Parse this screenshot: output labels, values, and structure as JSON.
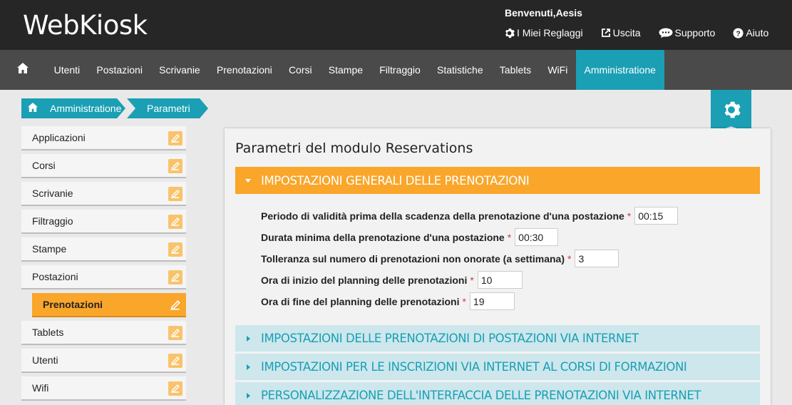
{
  "header": {
    "logo": "WebKiosk",
    "welcome": "Benvenuti,Aesis",
    "links": [
      {
        "label": "I Miei Reglaggi",
        "icon": "gear-icon"
      },
      {
        "label": "Uscita",
        "icon": "exit-icon"
      },
      {
        "label": "Supporto",
        "icon": "chat-icon"
      },
      {
        "label": "Aiuto",
        "icon": "help-icon"
      }
    ]
  },
  "nav": {
    "home_icon": "home-icon",
    "items": [
      "Utenti",
      "Postazioni",
      "Scrivanie",
      "Prenotazioni",
      "Corsi",
      "Stampe",
      "Filtraggio",
      "Statistiche",
      "Tablets",
      "WiFi",
      "Amministratione"
    ],
    "active": "Amministratione"
  },
  "breadcrumb": {
    "items": [
      "Amministratione",
      "Parametri"
    ]
  },
  "sidebar": {
    "items": [
      {
        "label": "Applicazioni"
      },
      {
        "label": "Corsi"
      },
      {
        "label": "Scrivanie"
      },
      {
        "label": "Filtraggio"
      },
      {
        "label": "Stampe"
      },
      {
        "label": "Postazioni"
      },
      {
        "label": "Prenotazioni",
        "active": true
      },
      {
        "label": "Tablets"
      },
      {
        "label": "Utenti"
      },
      {
        "label": "Wifi"
      }
    ]
  },
  "main": {
    "title": "Parametri del modulo Reservations",
    "sections": [
      {
        "title": "IMPOSTAZIONI GENERALI DELLE PRENOTAZIONI",
        "open": true
      },
      {
        "title": "IMPOSTAZIONI DELLE PRENOTAZIONI DI POSTAZIONI VIA INTERNET",
        "open": false
      },
      {
        "title": "IMPOSTAZIONI PER LE INSCRIZIONI VIA INTERNET AL CORSI DI FORMAZIONI",
        "open": false
      },
      {
        "title": "PERSONALIZZAZIONE DELL'INTERFACCIA DELLE PRENOTAZIONI VIA INTERNET",
        "open": false
      }
    ],
    "fields": [
      {
        "label": "Periodo di validità prima della scadenza della prenotazione d'una postazione",
        "required": "*",
        "value": "00:15"
      },
      {
        "label": "Durata minima della prenotazione d'una postazione",
        "required": "*",
        "value": "00:30"
      },
      {
        "label": "Tolleranza sul numero di prenotazioni non onorate (a settimana)",
        "required": "*",
        "value": "3"
      },
      {
        "label": "Ora di inizio del planning delle prenotazioni",
        "required": "*",
        "value": "10"
      },
      {
        "label": "Ora di fine del planning delle prenotazioni",
        "required": "*",
        "value": "19"
      }
    ]
  },
  "colors": {
    "teal": "#1a9fb5",
    "orange": "#f9a62a",
    "header_bg": "#262626",
    "nav_bg": "#4a4a4a"
  }
}
